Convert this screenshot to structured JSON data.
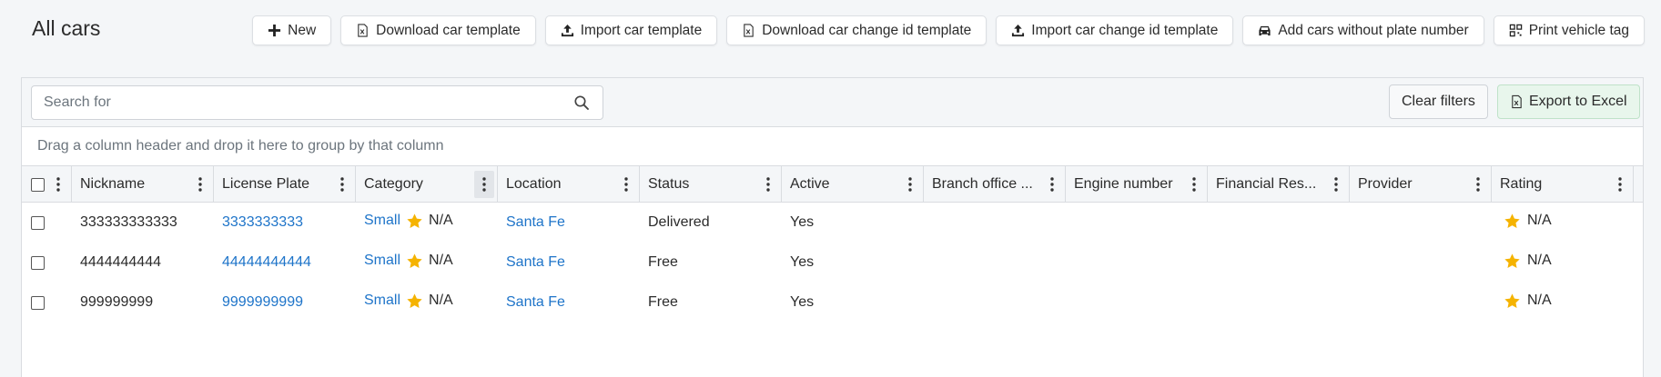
{
  "page": {
    "title": "All cars"
  },
  "actions": {
    "new": "New",
    "download_car_template": "Download car template",
    "import_car_template": "Import car template",
    "download_change_id_template": "Download car change id template",
    "import_change_id_template": "Import car change id template",
    "add_without_plate": "Add cars without plate number",
    "print_vehicle_tag": "Print vehicle tag"
  },
  "toolbar": {
    "search_placeholder": "Search for",
    "clear_filters": "Clear filters",
    "export_excel": "Export to Excel"
  },
  "group_panel": {
    "text": "Drag a column header and drop it here to group by that column"
  },
  "columns": [
    "Nickname",
    "License Plate",
    "Category",
    "Location",
    "Status",
    "Active",
    "Branch office ...",
    "Engine number",
    "Financial Res...",
    "Provider",
    "Rating"
  ],
  "rows": [
    {
      "nickname": "333333333333",
      "plate": "3333333333",
      "category": "Small",
      "category_rating": "N/A",
      "location": "Santa Fe",
      "status": "Delivered",
      "active": "Yes",
      "rating": "N/A"
    },
    {
      "nickname": "4444444444",
      "plate": "44444444444",
      "category": "Small",
      "category_rating": "N/A",
      "location": "Santa Fe",
      "status": "Free",
      "active": "Yes",
      "rating": "N/A"
    },
    {
      "nickname": "999999999",
      "plate": "9999999999",
      "category": "Small",
      "category_rating": "N/A",
      "location": "Santa Fe",
      "status": "Free",
      "active": "Yes",
      "rating": "N/A"
    }
  ],
  "colors": {
    "link": "#1e74c9",
    "star": "#f5b301",
    "excel": "#e8f6ec"
  }
}
